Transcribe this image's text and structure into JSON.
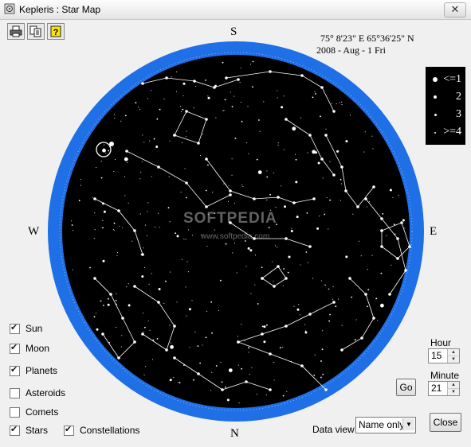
{
  "window": {
    "title": "Kepleris : Star Map",
    "close_glyph": "✕"
  },
  "toolbar": [
    {
      "name": "print-icon"
    },
    {
      "name": "copy-icon"
    },
    {
      "name": "help-icon"
    }
  ],
  "location": {
    "coords": "75° 8'23\" E   65°36'25\" N",
    "date": "2008 - Aug -  1   Fri"
  },
  "legend": {
    "labels": [
      "<=1",
      "2",
      "3",
      ">=4"
    ]
  },
  "directions": {
    "north": "N",
    "south": "S",
    "east": "E",
    "west": "W"
  },
  "watermark": {
    "text": "SOFTPEDIA",
    "url": "www.softpedia.com"
  },
  "options": [
    {
      "label": "Sun",
      "checked": true
    },
    {
      "label": "Moon",
      "checked": true
    },
    {
      "label": "Planets",
      "checked": true
    },
    {
      "label": "Asteroids",
      "checked": false
    },
    {
      "label": "Comets",
      "checked": false
    },
    {
      "label": "Stars",
      "checked": true
    },
    {
      "label": "Constellations",
      "checked": true
    }
  ],
  "time": {
    "hour_label": "Hour",
    "hour": "15",
    "minute_label": "Minute",
    "minute": "21"
  },
  "buttons": {
    "go": "Go",
    "close": "Close"
  },
  "data_view": {
    "label": "Data view",
    "value": "Name only"
  },
  "colors": {
    "ring": "#1f6fe6",
    "sky": "#000000",
    "window_bg": "#f0f0f0"
  }
}
